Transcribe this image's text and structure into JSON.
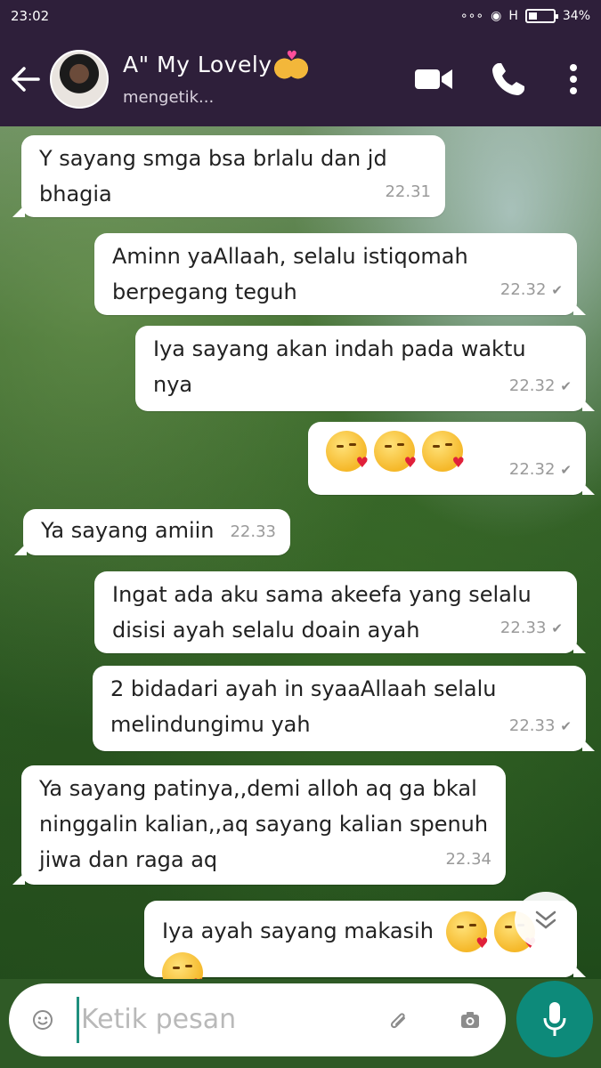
{
  "status_bar": {
    "time": "23:02",
    "network": "H",
    "battery_text": "34%",
    "battery_level": 0.34
  },
  "header": {
    "contact_name": "A\" My Lovely",
    "status": "mengetik...",
    "icons": [
      "back-arrow-icon",
      "avatar",
      "video-call-icon",
      "phone-icon",
      "more-icon"
    ]
  },
  "messages": [
    {
      "dir": "in",
      "text": "Y sayang smga bsa brlalu dan jd bhagia",
      "time": "22.31"
    },
    {
      "dir": "out",
      "lines": [
        "Aminn yaAllaah,  selalu istiqomah",
        "berpegang teguh"
      ],
      "time": "22.32"
    },
    {
      "dir": "out",
      "text": "Iya sayang akan indah pada waktu nya",
      "time": "22.32"
    },
    {
      "dir": "out",
      "emoji_count": 3,
      "emoji": "kissing-heart-emoji",
      "time": "22.32"
    },
    {
      "dir": "in",
      "text": "Ya sayang amiin",
      "time": "22.33"
    },
    {
      "dir": "out",
      "lines": [
        "Ingat ada aku sama akeefa yang selalu",
        "disisi ayah selalu doain ayah"
      ],
      "time": "22.33"
    },
    {
      "dir": "out",
      "lines": [
        "2 bidadari ayah in syaaAllaah selalu",
        "melindungimu yah"
      ],
      "time": "22.33"
    },
    {
      "dir": "in",
      "lines": [
        "Ya sayang patinya,,demi alloh aq ga bkal",
        "ninggalin kalian,,aq sayang kalian spenuh",
        "jiwa dan raga aq"
      ],
      "time": "22.34"
    },
    {
      "dir": "out",
      "text": "Iya ayah sayang makasih",
      "emoji_count": 3
    }
  ],
  "input": {
    "placeholder": "Ketik pesan"
  },
  "colors": {
    "header_bg": "#2e1f3a",
    "accent": "#0d8a7a"
  }
}
